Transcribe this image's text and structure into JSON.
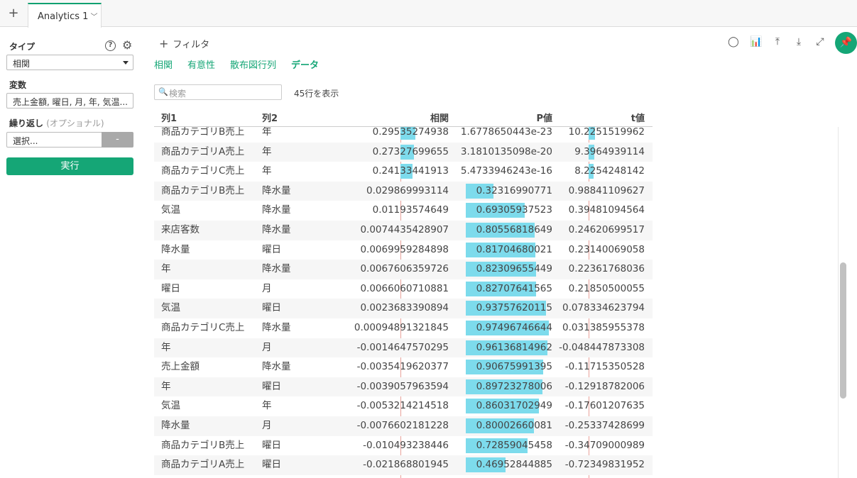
{
  "tabs": {
    "add_label": "+",
    "active_tab": "Analytics 1"
  },
  "left": {
    "type_label": "タイプ",
    "type_value": "相関",
    "vars_label": "変数",
    "vars_value": "売上金額, 曜日, 月, 年, 気温...",
    "repeat_label": "繰り返し",
    "repeat_optional": "(オプショナル)",
    "repeat_value": "選択...",
    "repeat_button": "-",
    "run_button": "実行"
  },
  "main": {
    "filter_label": "フィルタ",
    "subtabs": [
      "相関",
      "有意性",
      "散布図行列",
      "データ"
    ],
    "search_placeholder": "検索",
    "row_count": "45行を表示",
    "columns": [
      "列1",
      "列2",
      "相関",
      "P値",
      "t値"
    ],
    "rows": [
      {
        "c1": "商品カテゴリB売上",
        "c2": "年",
        "corr": "0.29535274938",
        "p": "1.6778650443e-23",
        "t": "10.2251519962",
        "corr_v": 0.29535274938,
        "p_v": 0,
        "t_v": 10.2251519962
      },
      {
        "c1": "商品カテゴリA売上",
        "c2": "年",
        "corr": "0.27327699655",
        "p": "3.1810135098e-20",
        "t": "9.3964939114",
        "corr_v": 0.27327699655,
        "p_v": 0,
        "t_v": 9.3964939114
      },
      {
        "c1": "商品カテゴリC売上",
        "c2": "年",
        "corr": "0.24133441913",
        "p": "5.4733946243e-16",
        "t": "8.2254248142",
        "corr_v": 0.24133441913,
        "p_v": 0,
        "t_v": 8.2254248142
      },
      {
        "c1": "商品カテゴリB売上",
        "c2": "降水量",
        "corr": "0.029869993114",
        "p": "0.32316990771",
        "t": "0.98841109627",
        "corr_v": 0.029869993114,
        "p_v": 0.32316990771,
        "t_v": 0.98841109627
      },
      {
        "c1": "気温",
        "c2": "降水量",
        "corr": "0.01193574649",
        "p": "0.69305937523",
        "t": "0.39481094564",
        "corr_v": 0.01193574649,
        "p_v": 0.69305937523,
        "t_v": 0.39481094564
      },
      {
        "c1": "来店客数",
        "c2": "降水量",
        "corr": "0.0074435428907",
        "p": "0.80556818649",
        "t": "0.24620699517",
        "corr_v": 0.0074435428907,
        "p_v": 0.80556818649,
        "t_v": 0.24620699517
      },
      {
        "c1": "降水量",
        "c2": "曜日",
        "corr": "0.0069959284898",
        "p": "0.81704680021",
        "t": "0.23140069058",
        "corr_v": 0.0069959284898,
        "p_v": 0.81704680021,
        "t_v": 0.23140069058
      },
      {
        "c1": "年",
        "c2": "降水量",
        "corr": "0.0067606359726",
        "p": "0.82309655449",
        "t": "0.22361768036",
        "corr_v": 0.0067606359726,
        "p_v": 0.82309655449,
        "t_v": 0.22361768036
      },
      {
        "c1": "曜日",
        "c2": "月",
        "corr": "0.0066060710881",
        "p": "0.82707641565",
        "t": "0.21850500055",
        "corr_v": 0.0066060710881,
        "p_v": 0.82707641565,
        "t_v": 0.21850500055
      },
      {
        "c1": "気温",
        "c2": "曜日",
        "corr": "0.0023683390894",
        "p": "0.93757620115",
        "t": "0.078334623794",
        "corr_v": 0.0023683390894,
        "p_v": 0.93757620115,
        "t_v": 0.078334623794
      },
      {
        "c1": "商品カテゴリC売上",
        "c2": "降水量",
        "corr": "0.00094891321845",
        "p": "0.97496746644",
        "t": "0.031385955378",
        "corr_v": 0.00094891321845,
        "p_v": 0.97496746644,
        "t_v": 0.031385955378
      },
      {
        "c1": "年",
        "c2": "月",
        "corr": "-0.0014647570295",
        "p": "0.96136814962",
        "t": "-0.048447873308",
        "corr_v": -0.0014647570295,
        "p_v": 0.96136814962,
        "t_v": -0.048447873308
      },
      {
        "c1": "売上金額",
        "c2": "降水量",
        "corr": "-0.0035419620377",
        "p": "0.90675991395",
        "t": "-0.11715350528",
        "corr_v": -0.0035419620377,
        "p_v": 0.90675991395,
        "t_v": -0.11715350528
      },
      {
        "c1": "年",
        "c2": "曜日",
        "corr": "-0.0039057963594",
        "p": "0.89723278006",
        "t": "-0.12918782006",
        "corr_v": -0.0039057963594,
        "p_v": 0.89723278006,
        "t_v": -0.12918782006
      },
      {
        "c1": "気温",
        "c2": "年",
        "corr": "-0.0053214214518",
        "p": "0.86031702949",
        "t": "-0.17601207635",
        "corr_v": -0.0053214214518,
        "p_v": 0.86031702949,
        "t_v": -0.17601207635
      },
      {
        "c1": "降水量",
        "c2": "月",
        "corr": "-0.0076602181228",
        "p": "0.80002660081",
        "t": "-0.25337428699",
        "corr_v": -0.0076602181228,
        "p_v": 0.80002660081,
        "t_v": -0.25337428699
      },
      {
        "c1": "商品カテゴリB売上",
        "c2": "曜日",
        "corr": "-0.010493238446",
        "p": "0.72859045458",
        "t": "-0.34709000989",
        "corr_v": -0.010493238446,
        "p_v": 0.72859045458,
        "t_v": -0.34709000989
      },
      {
        "c1": "商品カテゴリA売上",
        "c2": "曜日",
        "corr": "-0.021868801945",
        "p": "0.46952844885",
        "t": "-0.72349831952",
        "corr_v": -0.021868801945,
        "p_v": 0.46952844885,
        "t_v": -0.72349831952
      }
    ]
  },
  "toolbar": {
    "icons": [
      "comment-icon",
      "chart-icon",
      "upload-icon",
      "download-icon",
      "expand-icon",
      "pin-icon"
    ]
  },
  "colors": {
    "accent": "#15a676",
    "bar": "#7ddbec",
    "zero_line": "#e38a80"
  }
}
